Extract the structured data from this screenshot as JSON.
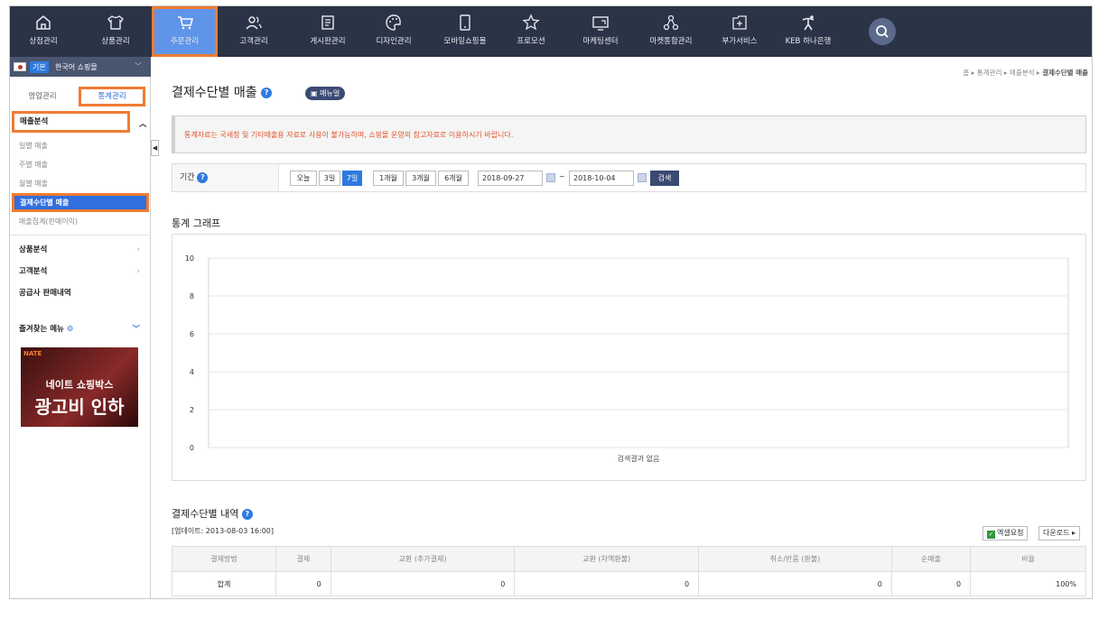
{
  "nav": {
    "items": [
      {
        "label": "상점관리",
        "icon": "home-icon"
      },
      {
        "label": "상품관리",
        "icon": "shirt-icon"
      },
      {
        "label": "주문관리",
        "icon": "cart-icon"
      },
      {
        "label": "고객관리",
        "icon": "users-icon"
      },
      {
        "label": "게시판관리",
        "icon": "board-icon"
      },
      {
        "label": "디자인관리",
        "icon": "palette-icon"
      },
      {
        "label": "모바일쇼핑몰",
        "icon": "mobile-icon"
      },
      {
        "label": "프로모션",
        "icon": "star-icon"
      },
      {
        "label": "마케팅센터",
        "icon": "monitor-icon"
      },
      {
        "label": "마켓통합관리",
        "icon": "nodes-icon"
      },
      {
        "label": "부가서비스",
        "icon": "plus-box-icon"
      },
      {
        "label": "KEB 하나은행",
        "icon": "bank-icon"
      }
    ]
  },
  "sidebar": {
    "shop_badge": "기본",
    "shop_name": "한국어 쇼핑몰",
    "tabs": [
      "영업관리",
      "통계관리"
    ],
    "section_title": "매출분석",
    "section_items": [
      "일별 매출",
      "주별 매출",
      "월별 매출",
      "결제수단별 매출",
      "매출집계(판매이익)"
    ],
    "groups": [
      "상품분석",
      "고객분석"
    ],
    "supplier": "공급사 판매내역",
    "favorites": "즐겨찾는 메뉴",
    "banner": {
      "logo": "NATE",
      "line1": "네이트 쇼핑박스",
      "line2": "광고비 인하"
    }
  },
  "breadcrumb": [
    "홈",
    "통계관리",
    "매출분석",
    "결제수단별 매출"
  ],
  "page": {
    "title": "결제수단별 매출",
    "manual": "매뉴얼",
    "notice": "통계자료는 국세청 및 기타매출용 자료로 사용이 불가능하며, 쇼핑몰 운영의 참고자료로 이용하시기 바랍니다."
  },
  "period": {
    "label": "기간",
    "buttons": [
      "오늘",
      "3일",
      "7일",
      "1개월",
      "3개월",
      "6개월"
    ],
    "active": "7일",
    "start": "2018-09-27",
    "tilde": "~",
    "end": "2018-10-04",
    "search": "검색"
  },
  "chart_data": {
    "type": "line",
    "title": "통계 그래프",
    "x": [],
    "series": [],
    "ylim": [
      0,
      10
    ],
    "yticks": [
      "0",
      "2",
      "4",
      "6",
      "8",
      "10"
    ],
    "grid": true,
    "empty_message": "검색결과 없음"
  },
  "list": {
    "title": "결제수단별 내역",
    "updated": "[업데이트: 2013-08-03 16:00]",
    "excel": "엑셀요청",
    "download": "다운로드",
    "columns": [
      "결제방법",
      "결제",
      "교환 (추가결제)",
      "교환 (차액환불)",
      "취소/반품 (환불)",
      "순매출",
      "비율"
    ],
    "rows": [
      [
        "합계",
        "0",
        "0",
        "0",
        "0",
        "0",
        "100%"
      ]
    ]
  }
}
